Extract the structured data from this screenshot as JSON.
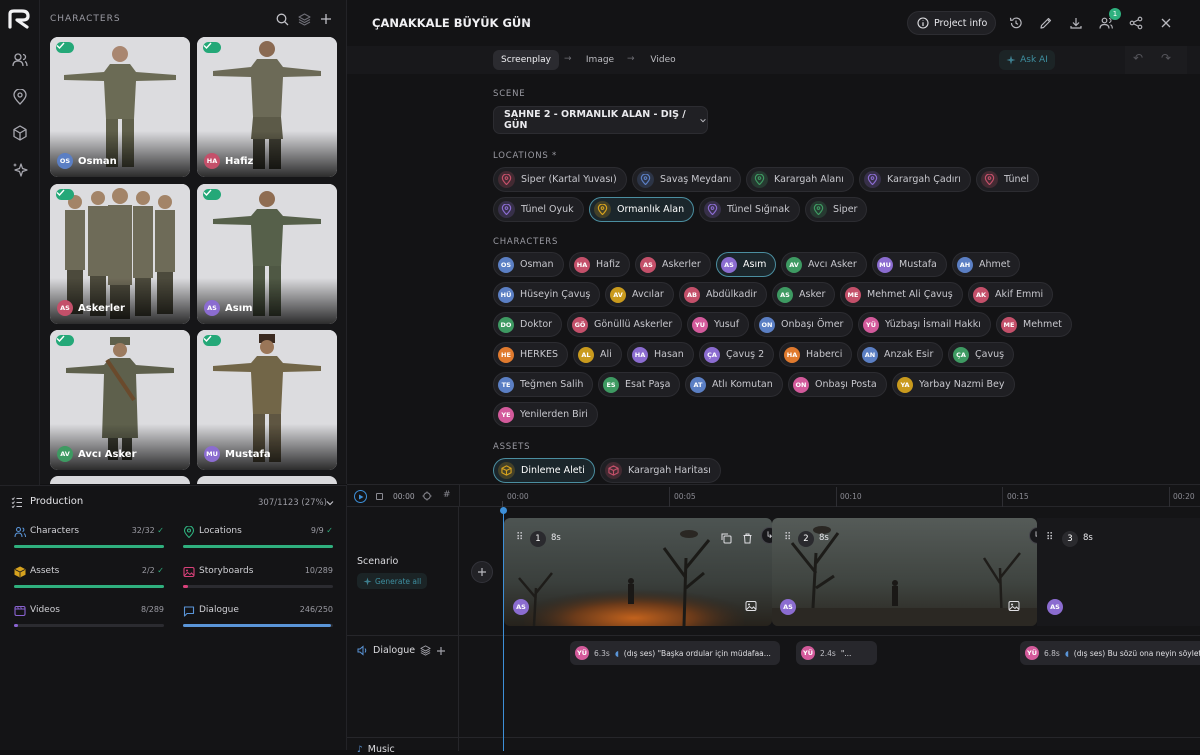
{
  "library": {
    "title": "CHARACTERS",
    "cards": [
      {
        "name": "Osman",
        "abbr": "OS",
        "color": "#5b7fc4"
      },
      {
        "name": "Hafiz",
        "abbr": "HA",
        "color": "#c4506a"
      },
      {
        "name": "Askerler",
        "abbr": "AS",
        "color": "#c4506a"
      },
      {
        "name": "Asım",
        "abbr": "AS",
        "color": "#8b6cd0"
      },
      {
        "name": "Avcı Asker",
        "abbr": "AV",
        "color": "#3e9a62"
      },
      {
        "name": "Mustafa",
        "abbr": "MU",
        "color": "#8b6cd0"
      }
    ]
  },
  "production": {
    "title": "Production",
    "total": "307/1123 (27%)",
    "stats": [
      {
        "label": "Characters",
        "count": "32/32",
        "done": true,
        "fraction": 1.0,
        "color": "#2fb07e"
      },
      {
        "label": "Locations",
        "count": "9/9",
        "done": true,
        "fraction": 1.0,
        "color": "#2fb07e"
      },
      {
        "label": "Assets",
        "count": "2/2",
        "done": true,
        "fraction": 1.0,
        "color": "#2fb07e"
      },
      {
        "label": "Storyboards",
        "count": "10/289",
        "done": false,
        "fraction": 0.035,
        "color": "#d9417a"
      },
      {
        "label": "Videos",
        "count": "8/289",
        "done": false,
        "fraction": 0.028,
        "color": "#8a63d2"
      },
      {
        "label": "Dialogue",
        "count": "246/250",
        "done": false,
        "fraction": 0.984,
        "color": "#5a95d8"
      }
    ]
  },
  "header": {
    "project_title": "ÇANAKKALE BÜYÜK GÜN",
    "project_info_label": "Project info",
    "notification_count": "1"
  },
  "tabs": {
    "items": [
      "Screenplay",
      "Image",
      "Video"
    ],
    "active": "Screenplay",
    "ask_ai": "Ask AI"
  },
  "scene": {
    "label": "SCENE",
    "value": "SAHNE 2 - ORMANLIK ALAN - DIŞ / GÜN"
  },
  "locations": {
    "label": "LOCATIONS *",
    "items": [
      {
        "name": "Siper (Kartal Yuvası)",
        "color": "#c4506a"
      },
      {
        "name": "Savaş Meydanı",
        "color": "#5b7fc4"
      },
      {
        "name": "Karargah Alanı",
        "color": "#3e9a62"
      },
      {
        "name": "Karargah Çadırı",
        "color": "#8b6cd0"
      },
      {
        "name": "Tünel",
        "color": "#c4506a"
      },
      {
        "name": "Tünel Oyuk",
        "color": "#8b6cd0"
      },
      {
        "name": "Ormanlık Alan",
        "color": "#d6a21e"
      },
      {
        "name": "Tünel Sığınak",
        "color": "#8b6cd0"
      },
      {
        "name": "Siper",
        "color": "#3e9a62"
      }
    ],
    "selected": "Ormanlık Alan"
  },
  "characters": {
    "label": "CHARACTERS",
    "items": [
      {
        "abbr": "OS",
        "name": "Osman",
        "color": "#5b7fc4"
      },
      {
        "abbr": "HA",
        "name": "Hafiz",
        "color": "#c4506a"
      },
      {
        "abbr": "AS",
        "name": "Askerler",
        "color": "#c4506a"
      },
      {
        "abbr": "AS",
        "name": "Asım",
        "color": "#8b6cd0"
      },
      {
        "abbr": "AV",
        "name": "Avcı Asker",
        "color": "#3e9a62"
      },
      {
        "abbr": "MU",
        "name": "Mustafa",
        "color": "#8b6cd0"
      },
      {
        "abbr": "AH",
        "name": "Ahmet",
        "color": "#5b7fc4"
      },
      {
        "abbr": "HÜ",
        "name": "Hüseyin Çavuş",
        "color": "#5b7fc4"
      },
      {
        "abbr": "AV",
        "name": "Avcılar",
        "color": "#c99a1d"
      },
      {
        "abbr": "AB",
        "name": "Abdülkadir",
        "color": "#c4506a"
      },
      {
        "abbr": "AS",
        "name": "Asker",
        "color": "#3e9a62"
      },
      {
        "abbr": "ME",
        "name": "Mehmet Ali Çavuş",
        "color": "#c4506a"
      },
      {
        "abbr": "AK",
        "name": "Akif Emmi",
        "color": "#c4506a"
      },
      {
        "abbr": "DO",
        "name": "Doktor",
        "color": "#3e9a62"
      },
      {
        "abbr": "GÖ",
        "name": "Gönüllü Askerler",
        "color": "#c4506a"
      },
      {
        "abbr": "YU",
        "name": "Yusuf",
        "color": "#d35a9b"
      },
      {
        "abbr": "ON",
        "name": "Onbaşı Ömer",
        "color": "#5b7fc4"
      },
      {
        "abbr": "YÜ",
        "name": "Yüzbaşı İsmail Hakkı",
        "color": "#d35a9b"
      },
      {
        "abbr": "ME",
        "name": "Mehmet",
        "color": "#c4506a"
      },
      {
        "abbr": "HE",
        "name": "HERKES",
        "color": "#e07a2e"
      },
      {
        "abbr": "AL",
        "name": "Ali",
        "color": "#c99a1d"
      },
      {
        "abbr": "HA",
        "name": "Hasan",
        "color": "#8b6cd0"
      },
      {
        "abbr": "ÇA",
        "name": "Çavuş 2",
        "color": "#8b6cd0"
      },
      {
        "abbr": "HA",
        "name": "Haberci",
        "color": "#e07a2e"
      },
      {
        "abbr": "AN",
        "name": "Anzak Esir",
        "color": "#5b7fc4"
      },
      {
        "abbr": "ÇA",
        "name": "Çavuş",
        "color": "#3e9a62"
      },
      {
        "abbr": "TE",
        "name": "Teğmen Salih",
        "color": "#5b7fc4"
      },
      {
        "abbr": "ES",
        "name": "Esat Paşa",
        "color": "#3e9a62"
      },
      {
        "abbr": "AT",
        "name": "Atlı Komutan",
        "color": "#5b7fc4"
      },
      {
        "abbr": "ON",
        "name": "Onbaşı Posta",
        "color": "#d35a9b"
      },
      {
        "abbr": "YA",
        "name": "Yarbay Nazmi Bey",
        "color": "#c99a1d"
      },
      {
        "abbr": "YE",
        "name": "Yenilerden Biri",
        "color": "#d35a9b"
      }
    ],
    "selected": "Asım"
  },
  "assets": {
    "label": "ASSETS",
    "items": [
      {
        "name": "Dinleme Aleti",
        "color": "#d6a21e"
      },
      {
        "name": "Karargah Haritası",
        "color": "#c4506a"
      }
    ],
    "selected": "Dinleme Aleti"
  },
  "timeline": {
    "time_display": "00:00",
    "ticks": [
      "00:00",
      "00:05",
      "00:10",
      "00:15",
      "00:20"
    ],
    "scenario_label": "Scenario",
    "generate_all_label": "Generate all",
    "dialogue_label": "Dialogue",
    "music_label": "Music",
    "clips": [
      {
        "number": "1",
        "duration": "8s",
        "avatar": "AS"
      },
      {
        "number": "2",
        "duration": "8s",
        "avatar": "AS"
      },
      {
        "number": "3",
        "duration": "8s",
        "avatar": "AS"
      }
    ],
    "dialogues": [
      {
        "avatar": "YÜ",
        "duration": "6.3s",
        "text": "(dış ses) \"Başka ordular için müdafaa..."
      },
      {
        "avatar": "YÜ",
        "duration": "2.4s",
        "text": "\"..."
      },
      {
        "avatar": "YÜ",
        "duration": "6.8s",
        "text": "(dış ses) Bu sözü ona neyin söylett"
      }
    ]
  }
}
